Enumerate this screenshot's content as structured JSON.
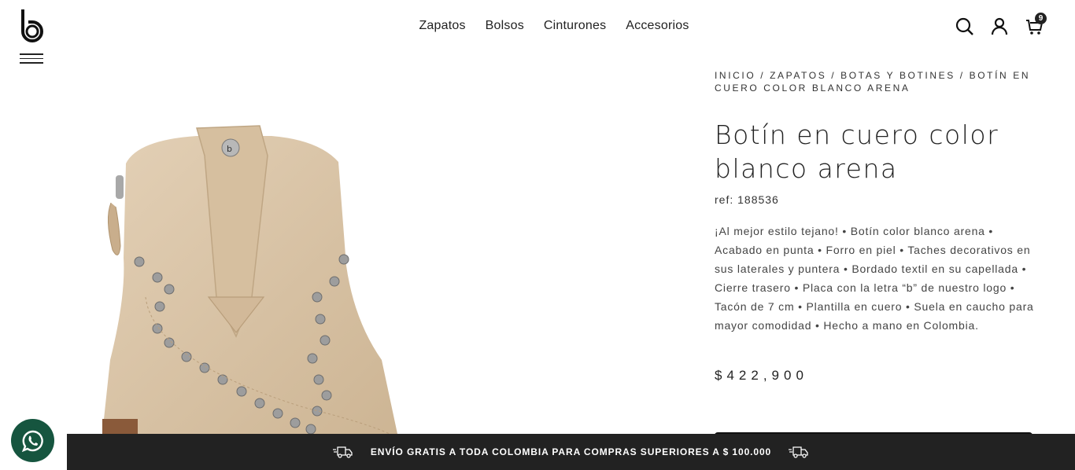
{
  "brand": {
    "logo_icon": "brand-b-logo"
  },
  "nav": {
    "items": [
      {
        "label": "Zapatos"
      },
      {
        "label": "Bolsos"
      },
      {
        "label": "Cinturones"
      },
      {
        "label": "Accesorios"
      }
    ]
  },
  "header": {
    "icons": [
      "search-icon",
      "user-icon",
      "cart-icon"
    ],
    "cart_count": "9"
  },
  "breadcrumb": {
    "items": [
      "INICIO",
      "ZAPATOS",
      "BOTAS Y BOTINES",
      "BOTÍN EN CUERO COLOR BLANCO ARENA"
    ],
    "separator": " / "
  },
  "product": {
    "title": "Botín en cuero color blanco arena",
    "ref": "ref: 188536",
    "description": "¡Al mejor estilo tejano! • Botín color blanco arena • Acabado en punta • Forro en piel • Taches decorativos en sus laterales y puntera • Bordado textil en su capellada • Cierre trasero • Placa con la letra “b” de nuestro logo • Tacón de 7 cm • Plantilla en cuero • Suela en caucho para mayor comodidad • Hecho a mano en Colombia.",
    "price": "$422,900"
  },
  "promo": {
    "text": "ENVÍO GRATIS A TODA COLOMBIA PARA COMPRAS SUPERIORES A $ 100.000",
    "icon": "truck-icon"
  },
  "colors": {
    "promo_bg": "#222222",
    "whatsapp": "#16553f",
    "leather": "#d9c4a8"
  }
}
